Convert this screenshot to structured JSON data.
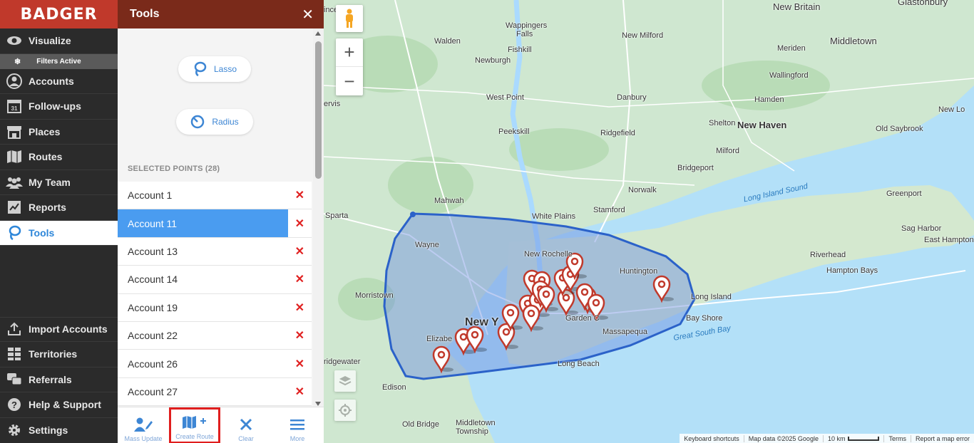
{
  "brand": "BADGER",
  "nav": {
    "items": [
      {
        "label": "Visualize",
        "icon": "eye-icon"
      },
      {
        "label": "Accounts",
        "icon": "person-icon"
      },
      {
        "label": "Follow-ups",
        "icon": "calendar-icon"
      },
      {
        "label": "Places",
        "icon": "store-icon"
      },
      {
        "label": "Routes",
        "icon": "map-icon"
      },
      {
        "label": "My Team",
        "icon": "team-icon"
      },
      {
        "label": "Reports",
        "icon": "chart-icon"
      },
      {
        "label": "Tools",
        "icon": "lasso-icon"
      }
    ],
    "filters_active": "Filters Active",
    "calendar_day": "31",
    "bottom_items": [
      {
        "label": "Import Accounts",
        "icon": "upload-icon"
      },
      {
        "label": "Territories",
        "icon": "grid-icon"
      },
      {
        "label": "Referrals",
        "icon": "chat-icon"
      },
      {
        "label": "Help & Support",
        "icon": "question-icon"
      },
      {
        "label": "Settings",
        "icon": "gear-icon"
      }
    ]
  },
  "panel": {
    "title": "Tools",
    "close": "✕",
    "lasso_label": "Lasso",
    "radius_label": "Radius",
    "selected_header": "SELECTED POINTS (28)",
    "selected": [
      "Account 1",
      "Account 11",
      "Account 13",
      "Account 14",
      "Account 19",
      "Account 22",
      "Account 26",
      "Account 27"
    ],
    "selected_active_index": 1,
    "toolbar": {
      "mass_update": "Mass Update",
      "create_route": "Create Route",
      "clear": "Clear",
      "more": "More"
    }
  },
  "map": {
    "labels": {
      "new_britain": "New Britain",
      "glastonbury": "Glastonbury",
      "wappingers": "Wappingers",
      "falls": "Falls",
      "walden": "Walden",
      "fishkill": "Fishkill",
      "new_milford": "New Milford",
      "middletown": "Middletown",
      "meriden": "Meriden",
      "wallingford": "Wallingford",
      "newburgh": "Newburgh",
      "west_point": "West Point",
      "danbury": "Danbury",
      "hamden": "Hamden",
      "new_lo": "New Lo",
      "peekskill": "Peekskill",
      "ridgefield": "Ridgefield",
      "shelton": "Shelton",
      "new_haven": "New Haven",
      "old_saybrook": "Old Saybrook",
      "milford": "Milford",
      "bridgeport": "Bridgeport",
      "norwalk": "Norwalk",
      "greenport": "Greenport",
      "stamford": "Stamford",
      "mahwah": "Mahwah",
      "white_plains": "White Plains",
      "sparta": "Sparta",
      "sag_harbor": "Sag Harbor",
      "east_hampton": "East Hampton",
      "wayne": "Wayne",
      "new_rochelle": "New Rochelle",
      "riverhead": "Riverhead",
      "huntington": "Huntington",
      "hampton_bays": "Hampton Bays",
      "morristown": "Morristown",
      "long_island": "Long Island",
      "new_york": "New Y",
      "garden_city": "Garden C",
      "bay_shore": "Bay Shore",
      "massapequa": "Massapequa",
      "elizabeth": "Elizabe",
      "bridgewater": "ridgewater",
      "long_beach": "Long Beach",
      "edison": "Edison",
      "old_bridge": "Old Bridge",
      "middletown_twp": "Middletown",
      "township": "Township",
      "ervis": "ervis",
      "incel": "incel",
      "long_island_sound": "Long Island Sound",
      "great_south_bay": "Great South Bay"
    },
    "attribution": {
      "shortcuts": "Keyboard shortcuts",
      "data": "Map data ©2025 Google",
      "scale": "10 km",
      "terms": "Terms",
      "report": "Report a map error"
    },
    "colors": {
      "land": "#cfe7d0",
      "water": "#aadaff",
      "lasso_fill": "#6d8fe0",
      "lasso_stroke": "#2b62c9",
      "pin": "#c0392b"
    }
  }
}
